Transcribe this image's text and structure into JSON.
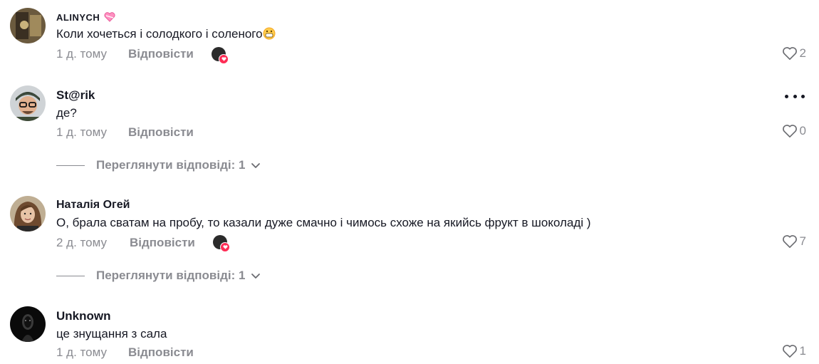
{
  "comments": [
    {
      "username": "ALINYCH",
      "username_badge": "pink-heart-emoji",
      "text": "Коли хочеться і солодкого і соленого",
      "text_emoji": "grinning-face-emoji",
      "time": "1 д. тому",
      "reply_label": "Відповісти",
      "liked_by_creator": true,
      "likes": "2",
      "more_menu": false
    },
    {
      "username": "St@rik",
      "text": "де?",
      "time": "1 д. тому",
      "reply_label": "Відповісти",
      "liked_by_creator": false,
      "likes": "0",
      "more_menu": true,
      "view_replies": "Переглянути відповіді: 1"
    },
    {
      "username": "Наталія Огей",
      "text": "О, брала сватам на пробу, то казали дуже смачно і чимось схоже на якийсь фрукт в шоколаді )",
      "time": "2 д. тому",
      "reply_label": "Відповісти",
      "liked_by_creator": true,
      "likes": "7",
      "more_menu": false,
      "view_replies": "Переглянути відповіді: 1"
    },
    {
      "username": "Unknown",
      "text": "це знущання з сала",
      "time": "1 д. тому",
      "reply_label": "Відповісти",
      "liked_by_creator": false,
      "likes": "1",
      "more_menu": false
    }
  ],
  "colors": {
    "text_primary": "#161823",
    "text_secondary": "#8a8b91",
    "creator_like_badge": "#fe2c55"
  }
}
